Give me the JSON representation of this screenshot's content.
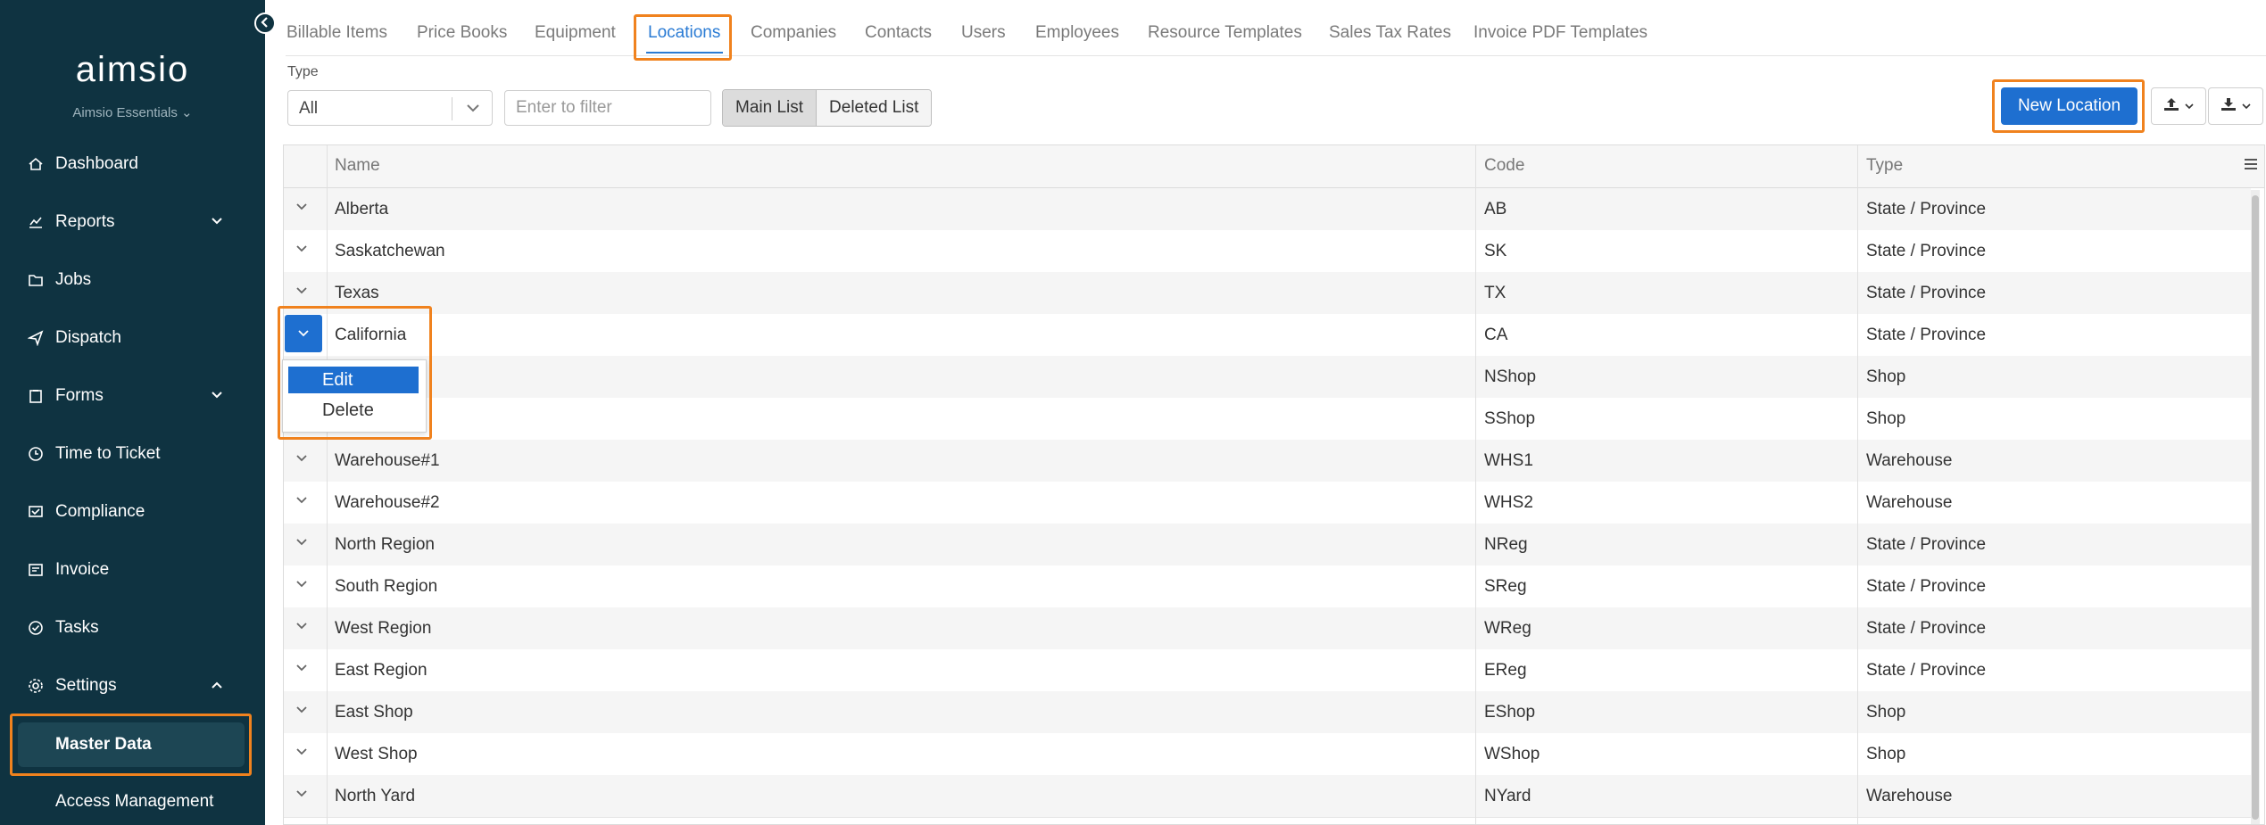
{
  "brand": {
    "logo": "aimsio",
    "edition": "Aimsio Essentials"
  },
  "sidebar": {
    "items": [
      {
        "label": "Dashboard",
        "icon": "home-icon"
      },
      {
        "label": "Reports",
        "icon": "chart-icon"
      },
      {
        "label": "Jobs",
        "icon": "folder-icon"
      },
      {
        "label": "Dispatch",
        "icon": "send-icon"
      },
      {
        "label": "Forms",
        "icon": "clipboard-icon"
      },
      {
        "label": "Time to Ticket",
        "icon": "clock-icon"
      },
      {
        "label": "Compliance",
        "icon": "compliance-icon"
      },
      {
        "label": "Invoice",
        "icon": "invoice-icon"
      },
      {
        "label": "Tasks",
        "icon": "check-circle-icon"
      },
      {
        "label": "Settings",
        "icon": "gear-icon"
      }
    ],
    "master_data": "Master Data",
    "access_management": "Access Management"
  },
  "tabs": [
    "Billable Items",
    "Price Books",
    "Equipment",
    "Locations",
    "Companies",
    "Contacts",
    "Users",
    "Employees",
    "Resource Templates",
    "Sales Tax Rates",
    "Invoice PDF Templates"
  ],
  "active_tab": "Locations",
  "toolbar": {
    "type_label": "Type",
    "type_value": "All",
    "filter_placeholder": "Enter to filter",
    "main_list": "Main List",
    "deleted_list": "Deleted List",
    "new_location": "New Location"
  },
  "grid": {
    "columns": [
      "Name",
      "Code",
      "Type"
    ],
    "rows": [
      {
        "name": "Alberta",
        "code": "AB",
        "type": "State / Province"
      },
      {
        "name": "Saskatchewan",
        "code": "SK",
        "type": "State / Province"
      },
      {
        "name": "Texas",
        "code": "TX",
        "type": "State / Province"
      },
      {
        "name": "California",
        "code": "CA",
        "type": "State / Province"
      },
      {
        "name": "",
        "code": "NShop",
        "type": "Shop"
      },
      {
        "name": "",
        "code": "SShop",
        "type": "Shop"
      },
      {
        "name": "Warehouse#1",
        "code": "WHS1",
        "type": "Warehouse"
      },
      {
        "name": "Warehouse#2",
        "code": "WHS2",
        "type": "Warehouse"
      },
      {
        "name": "North Region",
        "code": "NReg",
        "type": "State / Province"
      },
      {
        "name": "South Region",
        "code": "SReg",
        "type": "State / Province"
      },
      {
        "name": "West Region",
        "code": "WReg",
        "type": "State / Province"
      },
      {
        "name": "East Region",
        "code": "EReg",
        "type": "State / Province"
      },
      {
        "name": "East Shop",
        "code": "EShop",
        "type": "Shop"
      },
      {
        "name": "West Shop",
        "code": "WShop",
        "type": "Shop"
      },
      {
        "name": "North Yard",
        "code": "NYard",
        "type": "Warehouse"
      }
    ]
  },
  "row_menu": {
    "edit": "Edit",
    "delete": "Delete"
  },
  "colors": {
    "sidebar_bg": "#0f3341",
    "accent": "#1e6fd0",
    "highlight": "#f0821e"
  }
}
